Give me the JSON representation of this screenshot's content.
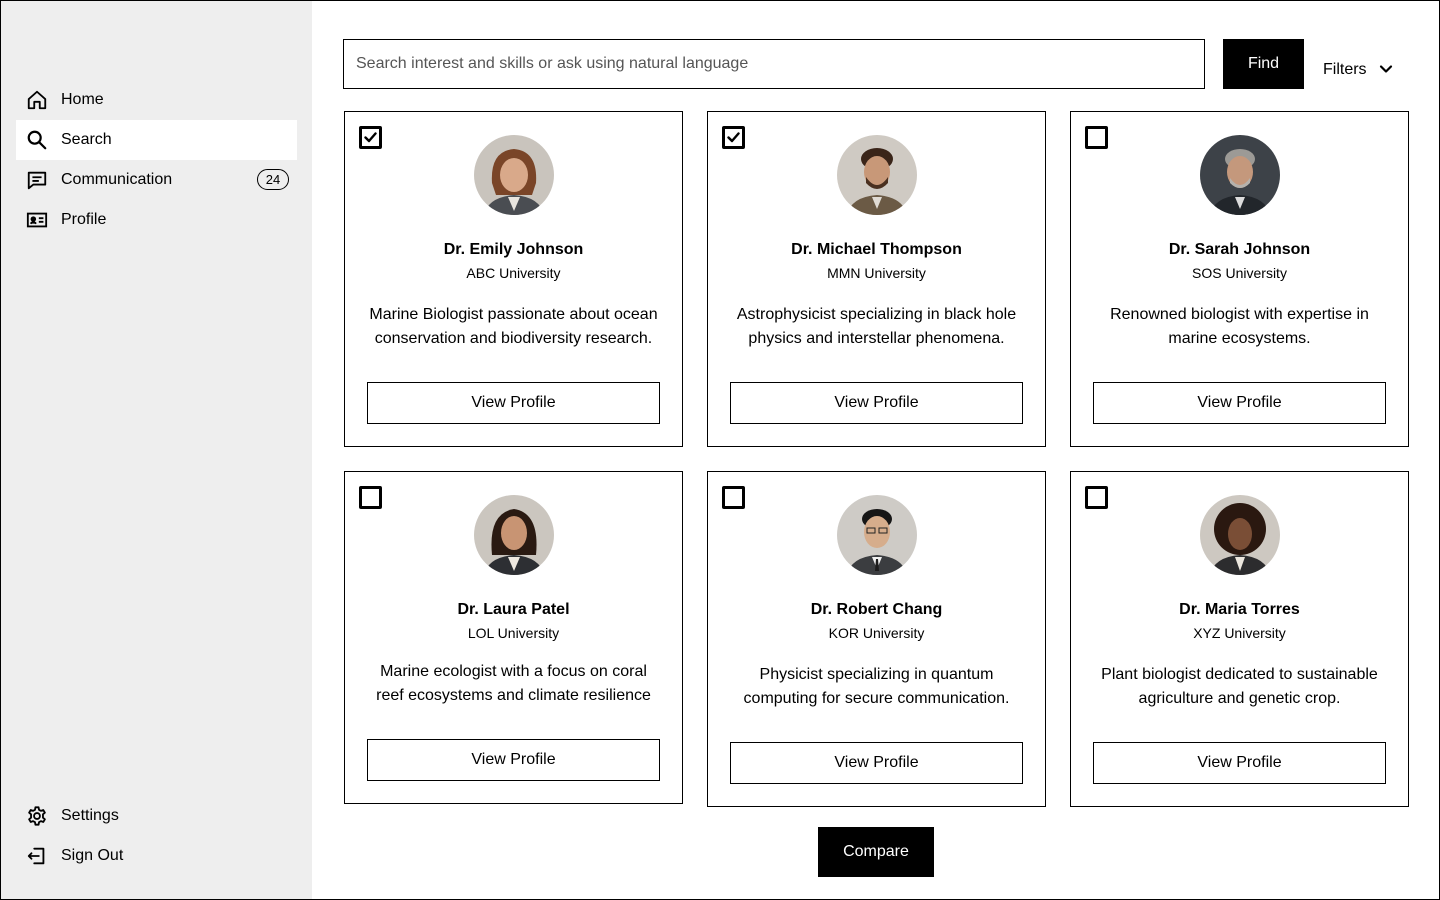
{
  "sidebar": {
    "items": [
      {
        "label": "Home",
        "icon": "home-icon"
      },
      {
        "label": "Search",
        "icon": "search-icon",
        "active": true
      },
      {
        "label": "Communication",
        "icon": "chat-icon",
        "badge": "24"
      },
      {
        "label": "Profile",
        "icon": "id-card-icon"
      }
    ],
    "bottom_items": [
      {
        "label": "Settings",
        "icon": "gear-icon"
      },
      {
        "label": "Sign Out",
        "icon": "sign-out-icon"
      }
    ]
  },
  "search": {
    "placeholder": "Search interest and skills or ask using natural language",
    "value": "",
    "find_label": "Find",
    "filters_label": "Filters"
  },
  "cards": [
    {
      "name": "Dr. Emily Johnson",
      "university": "ABC University",
      "bio": "Marine Biologist passionate about ocean conservation and biodiversity research.",
      "button": "View Profile",
      "checked": true
    },
    {
      "name": "Dr. Michael Thompson",
      "university": "MMN University",
      "bio": "Astrophysicist specializing in black hole physics and interstellar phenomena.",
      "button": "View Profile",
      "checked": true
    },
    {
      "name": "Dr. Sarah Johnson",
      "university": "SOS University",
      "bio": "Renowned biologist with expertise in marine ecosystems.",
      "button": "View Profile",
      "checked": false
    },
    {
      "name": "Dr. Laura Patel",
      "university": "LOL University",
      "bio": "Marine ecologist with a focus on coral reef ecosystems and climate resilience",
      "button": "View Profile",
      "checked": false
    },
    {
      "name": "Dr. Robert Chang",
      "university": "KOR University",
      "bio": "Physicist specializing in quantum computing for secure communication.",
      "button": "View Profile",
      "checked": false
    },
    {
      "name": "Dr. Maria Torres",
      "university": "XYZ University",
      "bio": "Plant biologist dedicated to sustainable agriculture and genetic crop.",
      "button": "View Profile",
      "checked": false
    }
  ],
  "compare_label": "Compare",
  "colors": {
    "sidebar_bg": "#eeeeee",
    "accent": "#000000",
    "active_item_bg": "#ffffff"
  }
}
